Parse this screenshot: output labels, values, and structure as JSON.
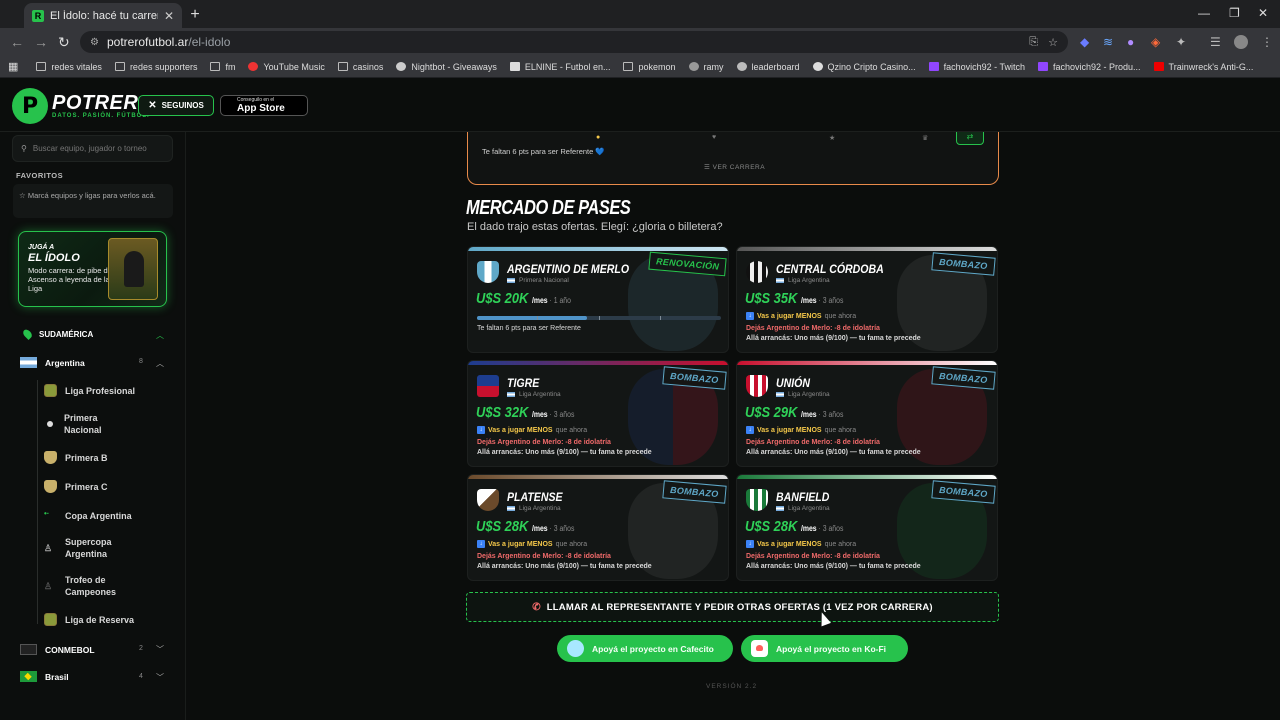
{
  "browser": {
    "tab_title": "El Ídolo: hacé tu carrera en la Li...",
    "tab_favicon": "R",
    "url_host": "potrerofutbol.ar",
    "url_path": "/el-idolo",
    "bookmarks": [
      "redes vitales",
      "redes supporters",
      "fm",
      "YouTube Music",
      "casinos",
      "Nightbot - Giveaways",
      "ELNINE - Futbol en...",
      "pokemon",
      "ramy",
      "leaderboard",
      "Qzino Cripto Casino...",
      "fachovich92 - Twitch",
      "fachovich92 - Produ...",
      "Trainwreck's Anti-G..."
    ]
  },
  "header": {
    "logo_letter": "P",
    "logo_text": "POTRERO",
    "logo_tagline": "DATOS. PASIÓN. FÚTBOL.",
    "x_button": "SEGUINOS",
    "app_small": "Conseguilo en el",
    "app_big": "App Store"
  },
  "sidebar": {
    "search_placeholder": "Buscar equipo, jugador o torneo",
    "favorites_title": "FAVORITOS",
    "favorites_hint": "Marcá equipos y ligas para verlos acá.",
    "promo": {
      "line1": "JUGÁ A",
      "line2": "EL ÍDOLO",
      "line3": "Modo carrera: de pibe del Ascenso a leyenda de la Liga"
    },
    "region": "SUDAMÉRICA",
    "country_argentina": "Argentina",
    "count_argentina": "8",
    "items": [
      "Liga Profesional",
      "Primera Nacional",
      "Primera B",
      "Primera C",
      "Copa Argentina",
      "Supercopa Argentina",
      "Trofeo de Campeones",
      "Liga de Reserva"
    ],
    "conmebol": "CONMEBOL",
    "count_conmebol": "2",
    "brasil": "Brasil",
    "count_brasil": "4"
  },
  "career": {
    "need": "Te faltan 6 pts para ser Referente 💙",
    "see_career": "☰  VER CARRERA"
  },
  "market": {
    "title": "MERCADO DE PASES",
    "subtitle": "El dado trajo estas ofertas. Elegí: ¿gloria o billetera?",
    "offers": [
      {
        "team": "ARGENTINO DE MERLO",
        "league": "Primera Nacional",
        "amount": "U$S 20K",
        "per": "/mes",
        "years": " · 1 año",
        "tag": "RENOVACIÓN",
        "progress": "Te faltan 6 pts para ser Referente",
        "progress_fill": 0.45
      },
      {
        "team": "CENTRAL CÓRDOBA",
        "league": "Liga Argentina",
        "amount": "U$S 35K",
        "per": "/mes",
        "years": " · 3 años",
        "tag": "BOMBAZO",
        "play": "Vas a jugar MENOS",
        "play_note": "que ahora",
        "leave": "Dejás Argentino de Merlo: -8 de idolatría",
        "start": "Allá arrancás: Uno más (9/100) — tu fama te precede"
      },
      {
        "team": "TIGRE",
        "league": "Liga Argentina",
        "amount": "U$S 32K",
        "per": "/mes",
        "years": " · 3 años",
        "tag": "BOMBAZO",
        "play": "Vas a jugar MENOS",
        "play_note": "que ahora",
        "leave": "Dejás Argentino de Merlo: -8 de idolatría",
        "start": "Allá arrancás: Uno más (9/100) — tu fama te precede"
      },
      {
        "team": "UNIÓN",
        "league": "Liga Argentina",
        "amount": "U$S 29K",
        "per": "/mes",
        "years": " · 3 años",
        "tag": "BOMBAZO",
        "play": "Vas a jugar MENOS",
        "play_note": "que ahora",
        "leave": "Dejás Argentino de Merlo: -8 de idolatría",
        "start": "Allá arrancás: Uno más (9/100) — tu fama te precede"
      },
      {
        "team": "PLATENSE",
        "league": "Liga Argentina",
        "amount": "U$S 28K",
        "per": "/mes",
        "years": " · 3 años",
        "tag": "BOMBAZO",
        "play": "Vas a jugar MENOS",
        "play_note": "que ahora",
        "leave": "Dejás Argentino de Merlo: -8 de idolatría",
        "start": "Allá arrancás: Uno más (9/100) — tu fama te precede"
      },
      {
        "team": "BANFIELD",
        "league": "Liga Argentina",
        "amount": "U$S 28K",
        "per": "/mes",
        "years": " · 3 años",
        "tag": "BOMBAZO",
        "play": "Vas a jugar MENOS",
        "play_note": "que ahora",
        "leave": "Dejás Argentino de Merlo: -8 de idolatría",
        "start": "Allá arrancás: Uno más (9/100) — tu fama te precede"
      }
    ],
    "call_button": "LLAMAR AL REPRESENTANTE Y PEDIR OTRAS OFERTAS (1 VEZ POR CARRERA)",
    "donate_cafecito": "Apoyá el proyecto en Cafecito",
    "donate_kofi": "Apoyá el proyecto en Ko-Fi",
    "version": "VERSIÓN 2.2"
  },
  "colors": {
    "accent": "#27c24c",
    "money": "#2fd158",
    "warning": "#f06a6a",
    "career_border": "#e88a4a"
  },
  "icons": [
    "search-icon",
    "star-icon",
    "apple-icon",
    "x-logo-icon",
    "phone-icon",
    "chevron-up-icon",
    "chevron-down-icon",
    "info-icon"
  ]
}
